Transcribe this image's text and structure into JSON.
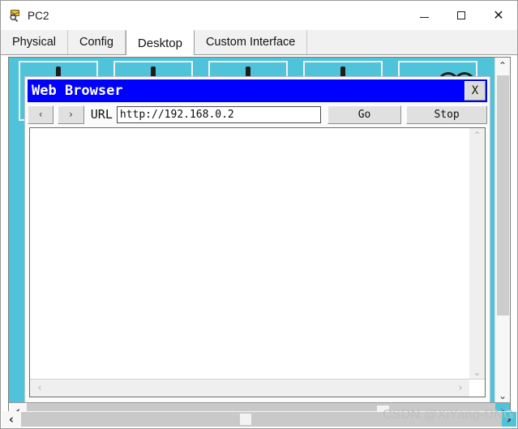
{
  "window": {
    "title": "PC2",
    "icon": "packet-tracer-device-icon",
    "controls": {
      "minimize": "—",
      "maximize": "□",
      "close": "✕"
    }
  },
  "tabs": [
    {
      "label": "Physical",
      "active": false
    },
    {
      "label": "Config",
      "active": false
    },
    {
      "label": "Desktop",
      "active": true
    },
    {
      "label": "Custom Interface",
      "active": false
    }
  ],
  "desktop": {
    "background_color": "#4ec3d9",
    "icons": [
      {
        "name": "desktop-icon-1"
      },
      {
        "name": "desktop-icon-2"
      },
      {
        "name": "desktop-icon-3"
      },
      {
        "name": "desktop-icon-4"
      },
      {
        "name": "desktop-icon-5"
      }
    ],
    "vscroll": {
      "up": "⌃",
      "down": "⌄"
    },
    "hscroll": {
      "left": "‹",
      "right": "›"
    }
  },
  "browser": {
    "title": "Web Browser",
    "title_bar_color": "#0000ff",
    "close_label": "X",
    "back_label": "‹",
    "forward_label": "›",
    "url_label": "URL",
    "url_value": "http://192.168.0.2",
    "url_placeholder": "http://",
    "go_label": "Go",
    "stop_label": "Stop",
    "page_content": "",
    "vscroll": {
      "up": "⌃",
      "down": "⌄"
    },
    "hscroll": {
      "left": "‹",
      "right": "›"
    }
  },
  "bottom_scrollbar": {
    "left_arrow": "‹",
    "right_arrow": "›"
  },
  "watermark": "CSDN @XiYang-DNG"
}
